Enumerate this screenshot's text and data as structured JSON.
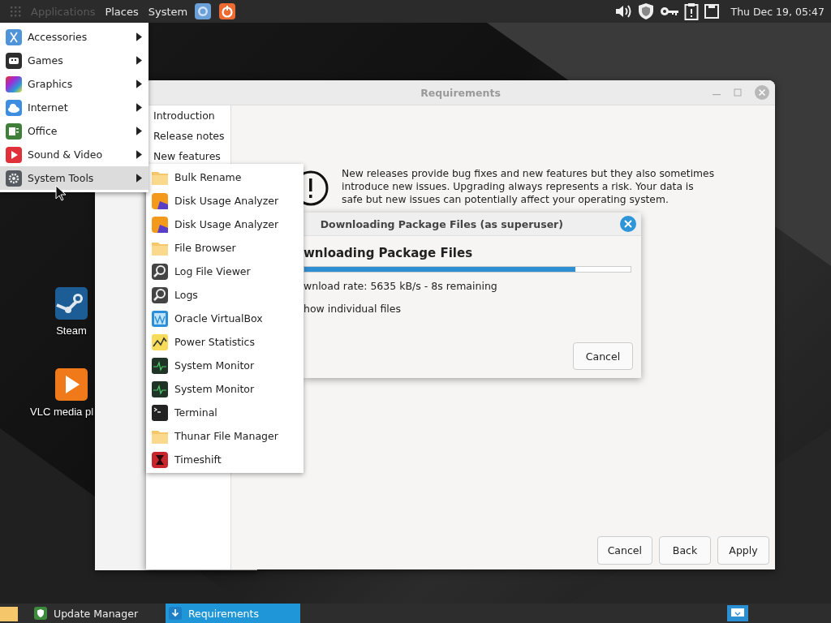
{
  "top_panel": {
    "menus": [
      {
        "label": "Applications",
        "selected": true
      },
      {
        "label": "Places",
        "selected": false
      },
      {
        "label": "System",
        "selected": false
      }
    ],
    "clock": "Thu Dec 19, 05:47"
  },
  "app_menu": {
    "items": [
      {
        "label": "Accessories",
        "selected": false
      },
      {
        "label": "Games",
        "selected": false
      },
      {
        "label": "Graphics",
        "selected": false
      },
      {
        "label": "Internet",
        "selected": false
      },
      {
        "label": "Office",
        "selected": false
      },
      {
        "label": "Sound & Video",
        "selected": false
      },
      {
        "label": "System Tools",
        "selected": true
      }
    ],
    "submenu": [
      "Bulk Rename",
      "Disk Usage Analyzer",
      "Disk Usage Analyzer",
      "File Browser",
      "Log File Viewer",
      "Logs",
      "Oracle VirtualBox",
      "Power Statistics",
      "System Monitor",
      "System Monitor",
      "Terminal",
      "Thunar File Manager",
      "Timeshift"
    ]
  },
  "desktop_icons": [
    {
      "label": "Steam"
    },
    {
      "label": "VLC media pl"
    }
  ],
  "window": {
    "title": "Requirements",
    "sidebar": [
      "Introduction",
      "Release notes",
      "New features"
    ],
    "message": "New releases provide bug fixes and new features but they also sometimes introduce new issues. Upgrading always represents a risk. Your data is safe but new issues can potentially affect your operating system.",
    "buttons": [
      "Cancel",
      "Back",
      "Apply"
    ]
  },
  "dialog": {
    "title": "Downloading Package Files (as superuser)",
    "heading": "wnloading Package Files",
    "progress": {
      "level": 0.83
    },
    "rate": "wnload rate: 5635 kB/s - 8s remaining",
    "checkbox_label": "how individual files",
    "button": "Cancel"
  },
  "taskbar": {
    "tasks": [
      {
        "label": "Update Manager",
        "selected": false
      },
      {
        "label": "Requirements",
        "selected": true
      }
    ]
  }
}
